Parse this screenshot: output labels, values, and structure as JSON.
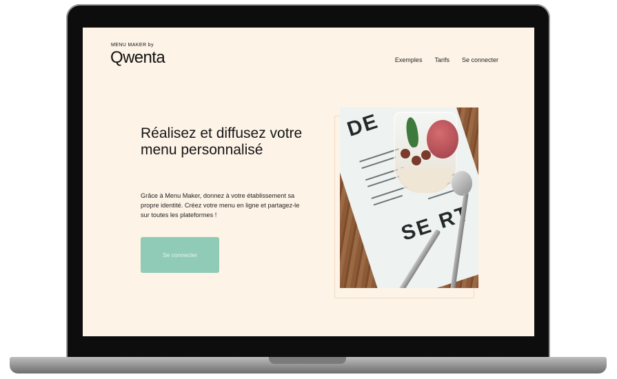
{
  "header": {
    "logo_small": "MENU MAKER by",
    "logo_big": "Qwenta"
  },
  "nav": {
    "items": [
      "Exemples",
      "Tarifs",
      "Se connecter"
    ]
  },
  "hero": {
    "title": "Réalisez et diffusez votre menu personnalisé",
    "description": "Grâce à Menu Maker, donnez à votre établissement sa propre identité. Créez votre menu en ligne et partagez-le sur toutes les plateformes !",
    "cta_label": "Se connecter"
  },
  "photo": {
    "text_top": "DE",
    "text_bottom": "SE RT"
  },
  "colors": {
    "page_background": "#fdf3e7",
    "cta_background": "#8fcbb6",
    "text": "#151515"
  }
}
